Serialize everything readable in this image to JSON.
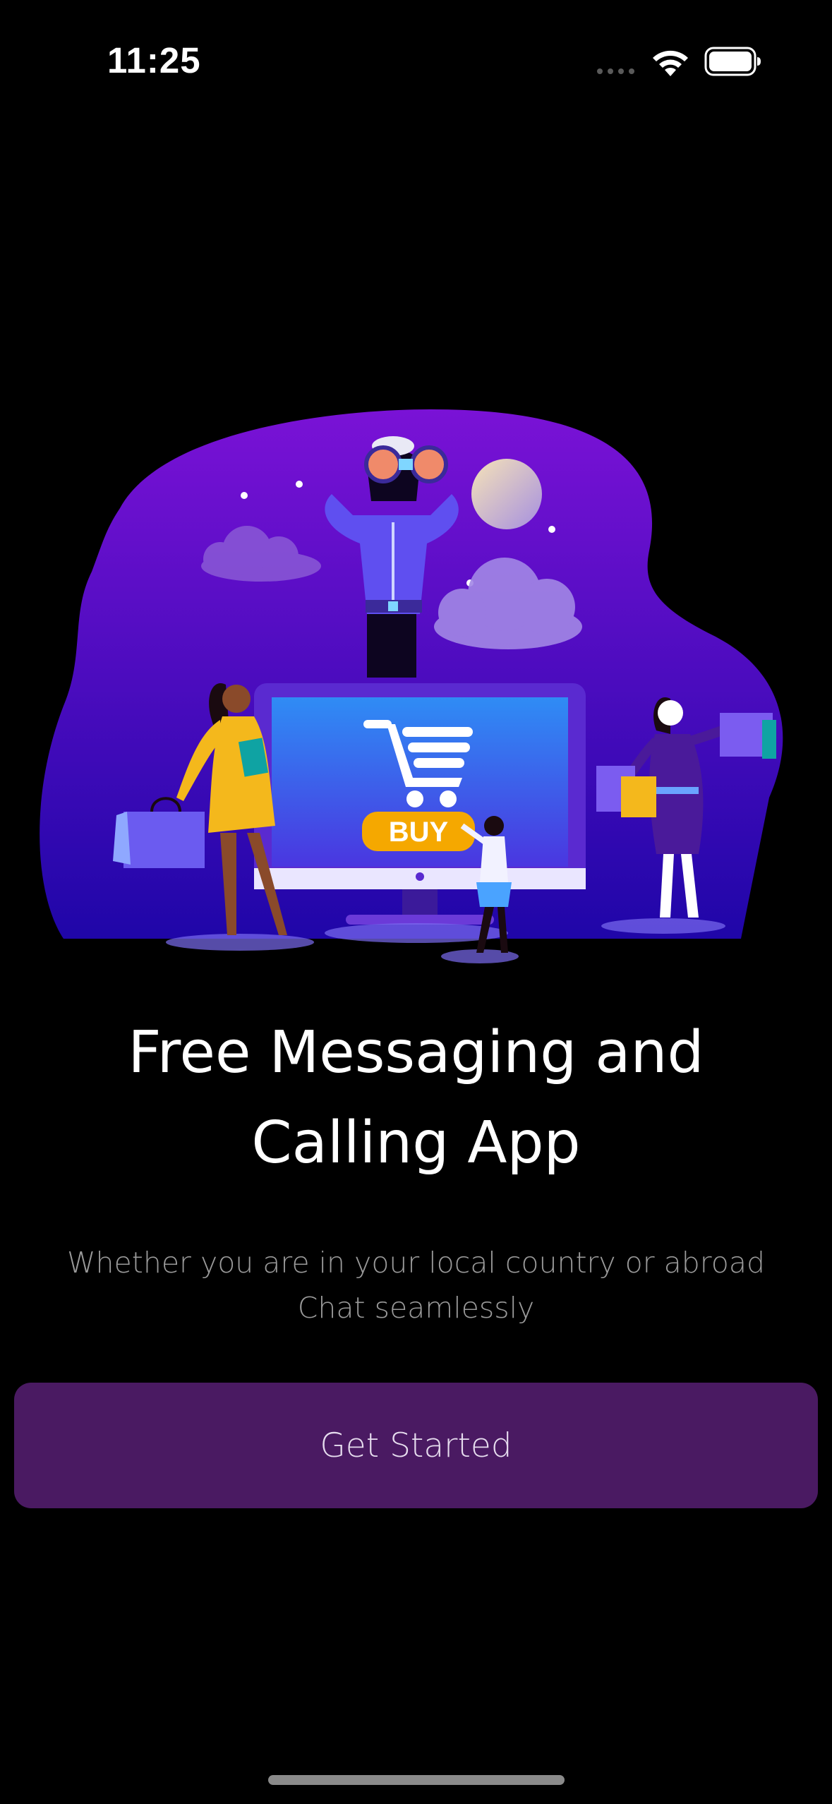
{
  "status_bar": {
    "time": "11:25",
    "icons": [
      "cellular-signal-icon",
      "wifi-icon",
      "battery-icon"
    ]
  },
  "illustration": {
    "buy_label": "BUY",
    "colors": {
      "blob_top": "#7a12d6",
      "blob_bottom": "#1f06a8",
      "screen": "#2f7ef0",
      "buy_badge": "#f5a800"
    }
  },
  "onboarding": {
    "headline_line1": "Free Messaging and",
    "headline_line2": "Calling App",
    "subtitle_line1": "Whether you are in your local country or abroad",
    "subtitle_line2": "Chat seamlessly",
    "button_label": "Get Started"
  },
  "colors": {
    "background": "#000000",
    "button": "#4a1a62",
    "text": "#ffffff",
    "subtitle": "#9a9a9a"
  }
}
